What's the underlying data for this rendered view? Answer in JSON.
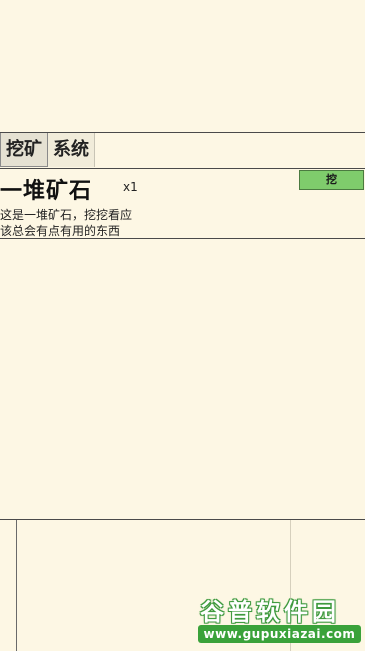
{
  "tabs": [
    {
      "label": "挖矿",
      "active": true
    },
    {
      "label": "系统",
      "active": false
    }
  ],
  "item": {
    "title": "一堆矿石",
    "count": "x1",
    "description_lines": [
      "这是一堆矿石，挖挖看应",
      "该总会有点有用的东西"
    ],
    "action_label": "挖"
  },
  "watermark": {
    "title": "谷普软件园",
    "url": "www.gupuxiazai.com"
  },
  "colors": {
    "background": "#fdf7e4",
    "action_button": "#7fcc6c",
    "watermark_green": "#3aa23a"
  }
}
